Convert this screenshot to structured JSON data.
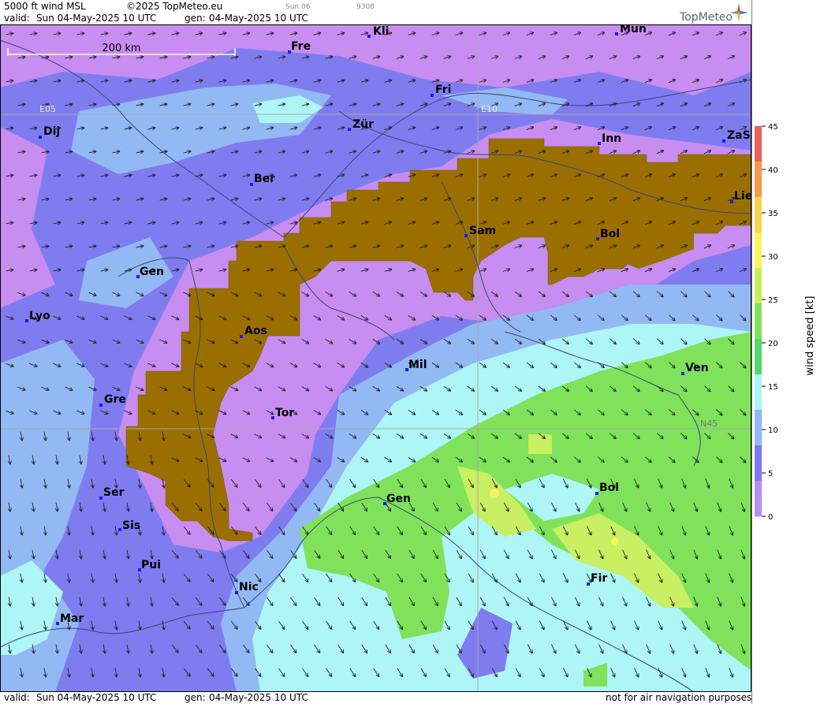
{
  "header": {
    "product": "5000 ft wind MSL",
    "copyright": "©2025 TopMeteo.eu",
    "small_date": "Sun 06",
    "small_num": "9308",
    "valid_label": "valid:",
    "valid_value": "Sun  04-May-2025  10 UTC",
    "gen_label": "gen:",
    "gen_value": "04-May-2025 10 UTC",
    "brand": "TopMeteo"
  },
  "footer": {
    "valid_label": "valid:",
    "valid_value": "Sun  04-May-2025  10 UTC",
    "gen_label": "gen:",
    "gen_value": "04-May-2025 10 UTC",
    "disclaimer": "not for air navigation purposes"
  },
  "map": {
    "scale_label": "200 km",
    "grid_labels": [
      "E05",
      "E10",
      "N45"
    ],
    "cities": [
      "Kli",
      "Mün",
      "Fre",
      "Fri",
      "Dij",
      "Zür",
      "Inn",
      "ZaS",
      "Ber",
      "Lie",
      "Sam",
      "Bol",
      "Gen",
      "Lyo",
      "Aos",
      "Mil",
      "Ven",
      "Gre",
      "Tor",
      "Ser",
      "Gen",
      "Bol",
      "Sis",
      "Pui",
      "Nic",
      "Fir",
      "Mar"
    ]
  },
  "legend": {
    "title": "wind speed [kt]",
    "ticks": [
      "45",
      "40",
      "35",
      "30",
      "25",
      "20",
      "15",
      "10",
      "5",
      "0"
    ],
    "colors": [
      "#e8635a",
      "#f39a4e",
      "#f9d34f",
      "#fbf35e",
      "#c6ee5c",
      "#7fe25a",
      "#53d86a",
      "#a9f4f6",
      "#8fb8f4",
      "#7d78ee",
      "#b88cf2"
    ]
  },
  "colors": {
    "calm": "#c78df0",
    "light": "#7f7cf0",
    "moderate": "#93b9f4",
    "fresh": "#aef5f6",
    "strong": "#7fe25a",
    "stronger": "#c9ef62",
    "terrain": "#9a6f00"
  }
}
